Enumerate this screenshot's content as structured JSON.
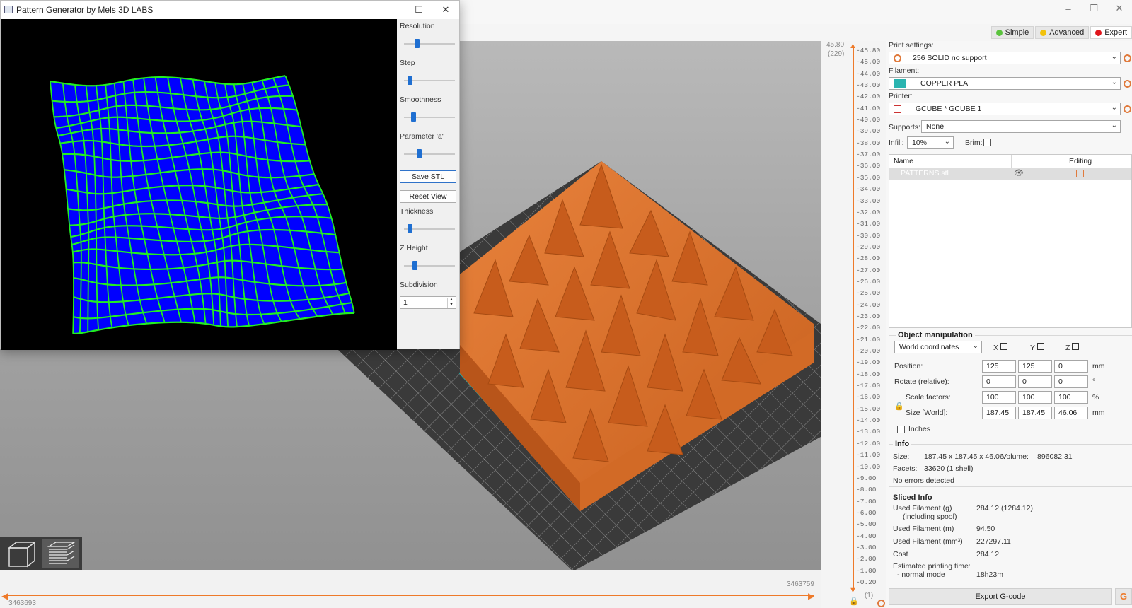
{
  "main_window": {
    "modes": [
      {
        "label": "Simple",
        "color": "#5ac33d"
      },
      {
        "label": "Advanced",
        "color": "#f2c20c"
      },
      {
        "label": "Expert",
        "color": "#e0161c"
      }
    ]
  },
  "layer_slider": {
    "top_value": "45.80",
    "top_layer": "(229)",
    "bottom_value": "0.20",
    "bottom_layer": "(1)",
    "ticks": [
      "45.80",
      "45.00",
      "44.00",
      "43.00",
      "42.00",
      "41.00",
      "40.00",
      "39.00",
      "38.00",
      "37.00",
      "36.00",
      "35.00",
      "34.00",
      "33.00",
      "32.00",
      "31.00",
      "30.00",
      "29.00",
      "28.00",
      "27.00",
      "26.00",
      "25.00",
      "24.00",
      "23.00",
      "22.00",
      "21.00",
      "20.00",
      "19.00",
      "18.00",
      "17.00",
      "16.00",
      "15.00",
      "14.00",
      "13.00",
      "12.00",
      "11.00",
      "10.00",
      "9.00",
      "8.00",
      "7.00",
      "6.00",
      "5.00",
      "4.00",
      "3.00",
      "2.00",
      "1.00",
      "0.20"
    ]
  },
  "horizontal_slider": {
    "left_value": "3463693",
    "right_value": "3463759"
  },
  "right_panel": {
    "print_settings_label": "Print settings:",
    "print_settings_value": "256 SOLID no support",
    "filament_label": "Filament:",
    "filament_value": "COPPER PLA",
    "filament_color": "#2ab4b0",
    "printer_label": "Printer:",
    "printer_value": "GCUBE * GCUBE 1",
    "supports_label": "Supports:",
    "supports_value": "None",
    "infill_label": "Infill:",
    "infill_value": "10%",
    "brim_label": "Brim:",
    "object_list": {
      "col_name": "Name",
      "col_editing": "Editing",
      "rows": [
        {
          "name": "PATTERNS.stl"
        }
      ]
    },
    "object_manipulation": {
      "title": "Object manipulation",
      "coord_system": "World coordinates",
      "axes": [
        "X",
        "Y",
        "Z"
      ],
      "rows": [
        {
          "label": "Position:",
          "values": [
            "125",
            "125",
            "0"
          ],
          "unit": "mm"
        },
        {
          "label": "Rotate (relative):",
          "values": [
            "0",
            "0",
            "0"
          ],
          "unit": "°"
        },
        {
          "label": "Scale factors:",
          "values": [
            "100",
            "100",
            "100"
          ],
          "unit": "%"
        },
        {
          "label": "Size [World]:",
          "values": [
            "187.45",
            "187.45",
            "46.06"
          ],
          "unit": "mm"
        }
      ],
      "inches_label": "Inches"
    },
    "info": {
      "title": "Info",
      "size_label": "Size:",
      "size_value": "187.45 x 187.45 x 46.06",
      "volume_label": "Volume:",
      "volume_value": "896082.31",
      "facets_label": "Facets:",
      "facets_value": "33620 (1 shell)",
      "errors": "No errors detected"
    },
    "sliced_info": {
      "title": "Sliced Info",
      "rows": [
        {
          "label": "Used Filament (g)",
          "sublabel": "(including spool)",
          "value": "284.12 (1284.12)"
        },
        {
          "label": "Used Filament (m)",
          "value": "94.50"
        },
        {
          "label": "Used Filament (mm³)",
          "value": "227297.11"
        },
        {
          "label": "Cost",
          "value": "284.12"
        },
        {
          "label": "Estimated printing time:",
          "sublabel": "- normal mode",
          "value": "18h23m"
        }
      ]
    },
    "export_label": "Export G-code"
  },
  "pattern_generator": {
    "title": "Pattern Generator by Mels 3D LABS",
    "controls": [
      {
        "label": "Resolution",
        "level": 0.22
      },
      {
        "label": "Step",
        "level": 0.08
      },
      {
        "label": "Smoothness",
        "level": 0.15
      },
      {
        "label": "Parameter 'a'",
        "level": 0.28
      },
      {
        "label": "Thickness",
        "level": 0.08
      },
      {
        "label": "Z Height",
        "level": 0.18
      }
    ],
    "save_label": "Save STL",
    "reset_label": "Reset View",
    "subdivision_label": "Subdivision",
    "subdivision_value": "1",
    "mesh_fill": "#0000ff",
    "mesh_line": "#22ee22"
  }
}
